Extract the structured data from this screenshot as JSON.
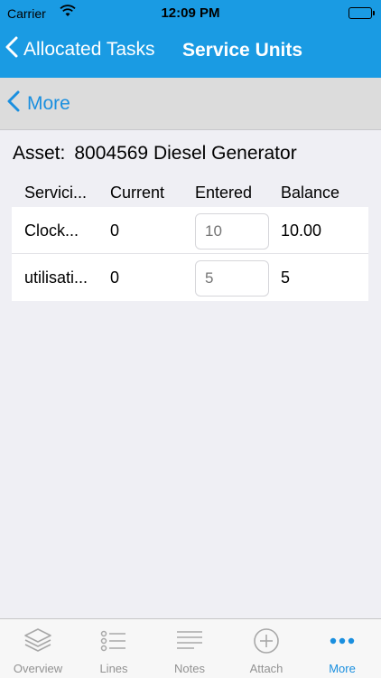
{
  "status_bar": {
    "carrier": "Carrier",
    "time": "12:09 PM"
  },
  "nav": {
    "back_label": "Allocated Tasks",
    "title": "Service Units"
  },
  "subnav": {
    "back_label": "More"
  },
  "asset": {
    "label": "Asset:",
    "value": "8004569 Diesel Generator"
  },
  "table": {
    "headers": [
      "Servici...",
      "Current",
      "Entered",
      "Balance"
    ],
    "rows": [
      {
        "name": "Clock...",
        "current": "0",
        "entered_placeholder": "10",
        "balance": "10.00"
      },
      {
        "name": "utilisati...",
        "current": "0",
        "entered_placeholder": "5",
        "balance": "5"
      }
    ]
  },
  "tabbar": {
    "tabs": [
      {
        "label": "Overview",
        "icon": "layers-icon"
      },
      {
        "label": "Lines",
        "icon": "list-icon"
      },
      {
        "label": "Notes",
        "icon": "notes-icon"
      },
      {
        "label": "Attach",
        "icon": "add-circle-icon"
      },
      {
        "label": "More",
        "icon": "more-dots-icon"
      }
    ],
    "active_color": "#1a8fdf",
    "inactive_color": "#929292"
  },
  "colors": {
    "header_blue": "#1a9be3",
    "accent": "#1a8fdf"
  }
}
